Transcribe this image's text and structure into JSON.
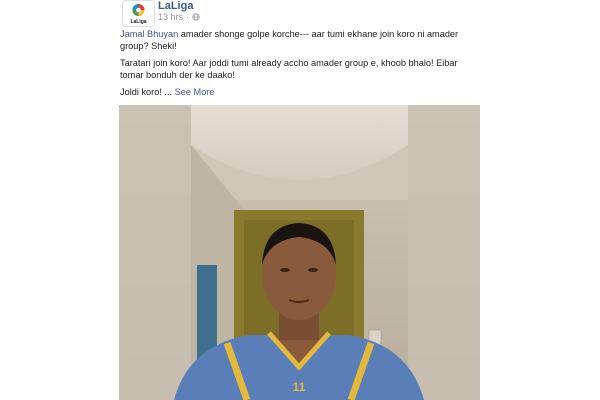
{
  "post": {
    "page_name": "LaLiga",
    "logo_text": "LaLiga",
    "timestamp": "13 hrs",
    "separator": "·",
    "privacy_icon": "globe-icon",
    "paragraph1": {
      "mention": "Jamal Bhuyan",
      "text": " amader shonge golpe korche--- aar tumi ekhane join koro ni amader group? Sheki!"
    },
    "paragraph2": "Taratari join koro! Aar joddi tumi already accho amader group e, khoob bhalo! Eibar tomar bonduh der ke daako!",
    "paragraph3": {
      "text": "Joldi koro!",
      "ellipsis": " ... ",
      "see_more": "See More"
    }
  },
  "video": {
    "jersey_number": "11",
    "colors": {
      "wall": "#d8d2c8",
      "door": "#8a7a2e",
      "jersey": "#5a7fb8",
      "jersey_trim": "#e2b93b",
      "skin": "#8a5a3c"
    }
  },
  "colors": {
    "link": "#365899",
    "meta": "#90949c",
    "text": "#1c1e21"
  }
}
